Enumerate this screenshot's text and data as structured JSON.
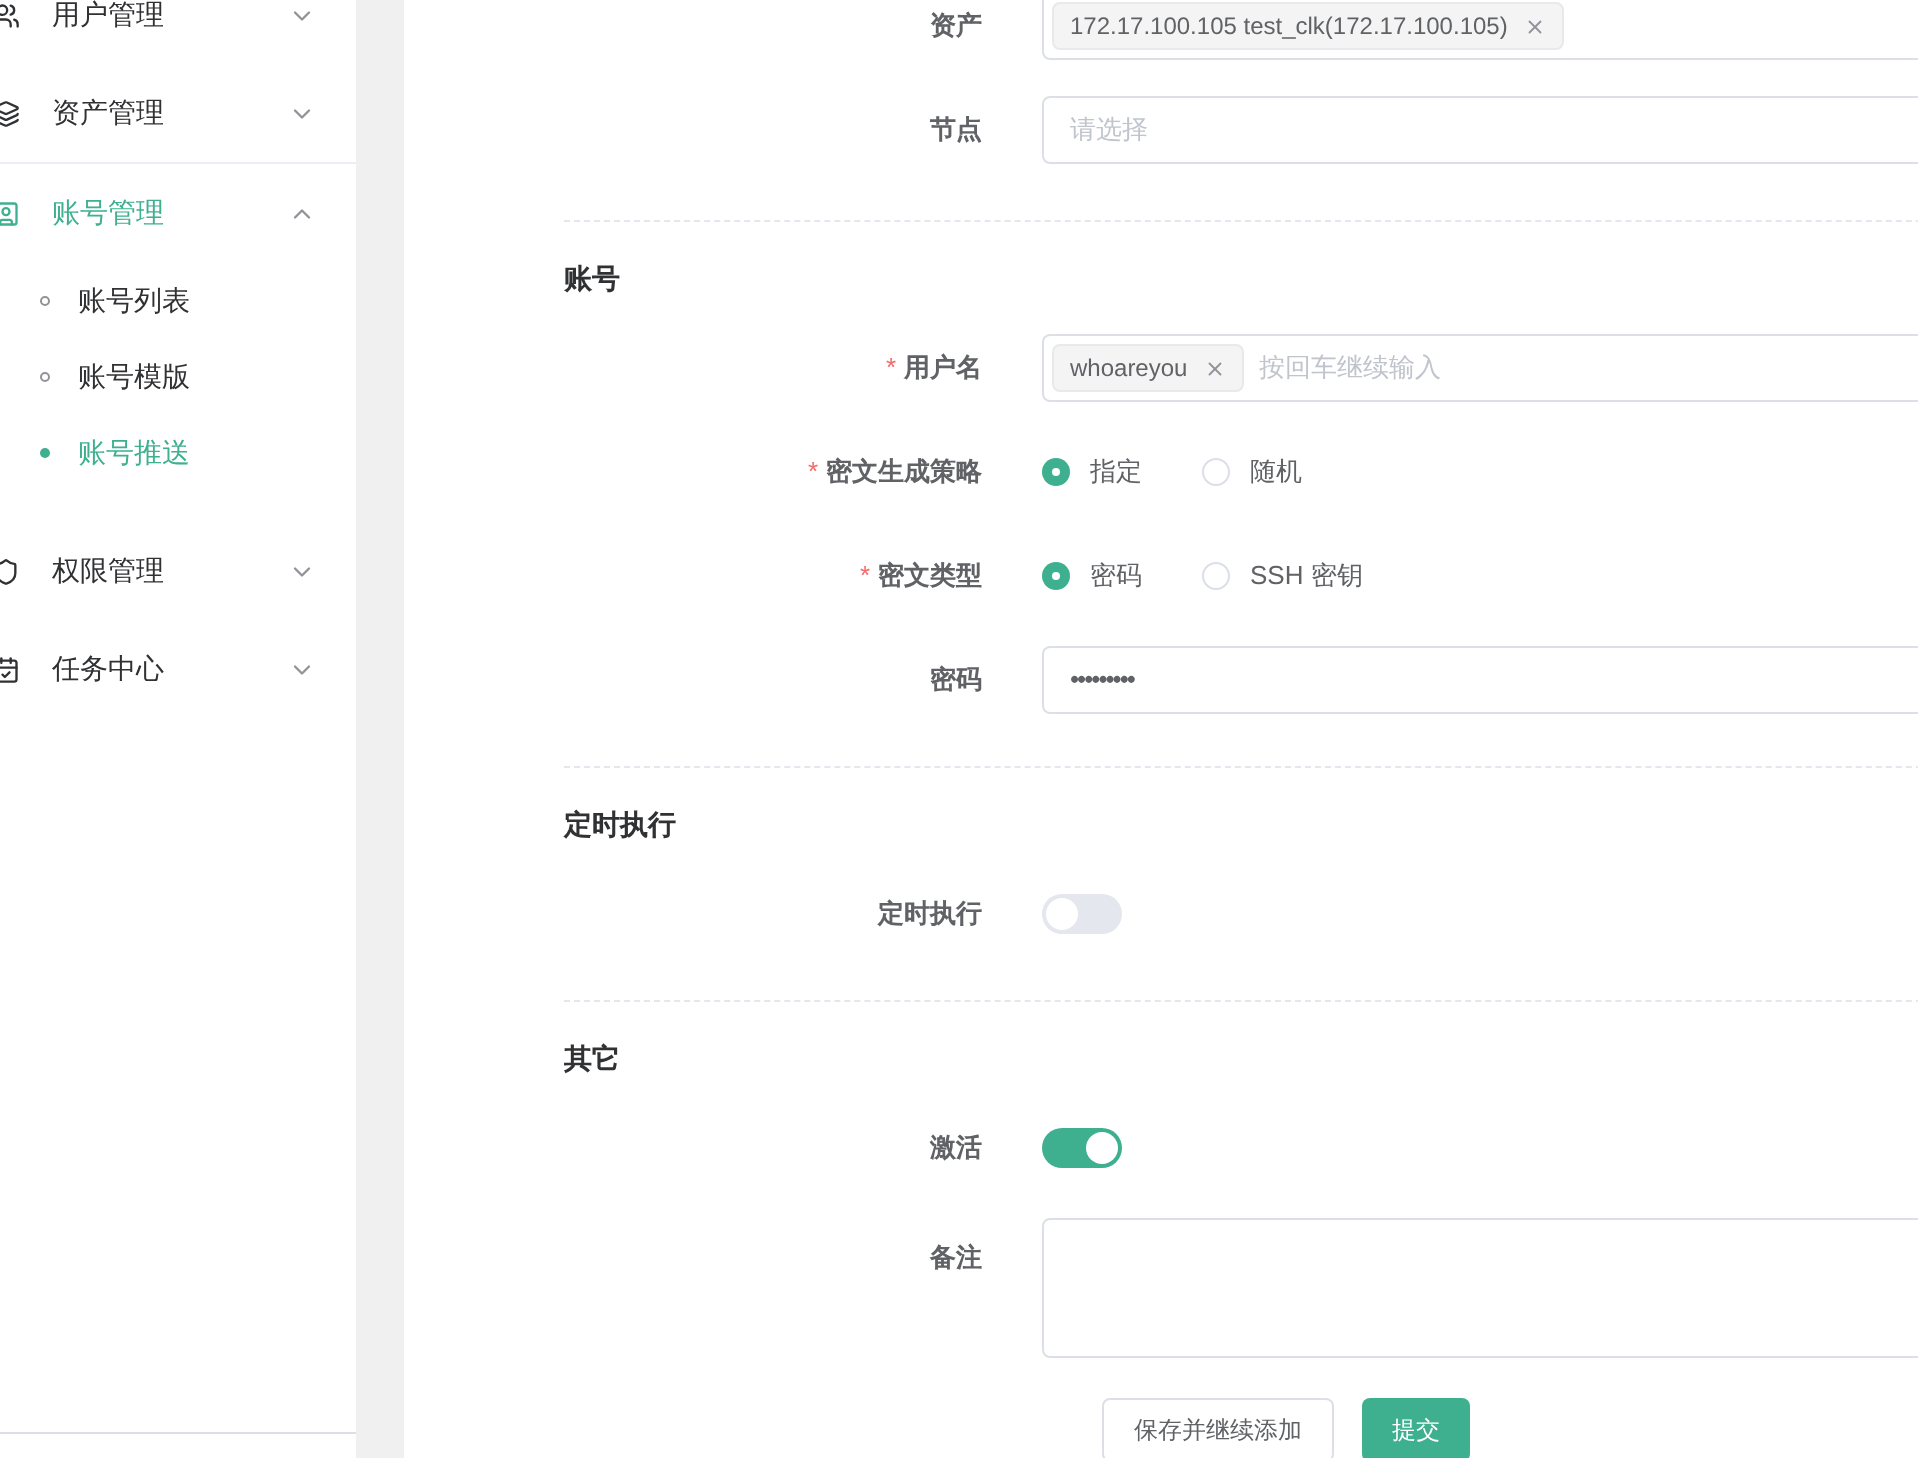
{
  "sidebar": {
    "items": [
      {
        "label": "用户管理",
        "selected": false,
        "expanded": false
      },
      {
        "label": "资产管理",
        "selected": false,
        "expanded": false
      },
      {
        "label": "账号管理",
        "selected": true,
        "expanded": true,
        "children": [
          {
            "label": "账号列表",
            "selected": false
          },
          {
            "label": "账号模版",
            "selected": false
          },
          {
            "label": "账号推送",
            "selected": true
          }
        ]
      },
      {
        "label": "权限管理",
        "selected": false,
        "expanded": false
      },
      {
        "label": "任务中心",
        "selected": false,
        "expanded": false
      }
    ]
  },
  "form": {
    "sections": [
      {
        "fields": [
          {
            "label": "资产",
            "kind": "tags",
            "tags": [
              "172.17.100.105 test_clk(172.17.100.105)"
            ]
          },
          {
            "label": "节点",
            "kind": "select",
            "placeholder": "请选择"
          }
        ]
      },
      {
        "heading": "账号",
        "fields": [
          {
            "label": "用户名",
            "kind": "tags",
            "required_mark": "*",
            "tags": [
              "whoareyou"
            ],
            "placeholder": "按回车继续输入"
          },
          {
            "label": "密文生成策略",
            "kind": "radio",
            "required_mark": "*",
            "options": [
              {
                "label": "指定",
                "selected": true
              },
              {
                "label": "随机",
                "selected": false
              }
            ]
          },
          {
            "label": "密文类型",
            "kind": "radio",
            "required_mark": "*",
            "options": [
              {
                "label": "密码",
                "selected": true
              },
              {
                "label": "SSH 密钥",
                "selected": false
              }
            ]
          },
          {
            "label": "密码",
            "kind": "password",
            "value": "•••••••••"
          }
        ]
      },
      {
        "heading": "定时执行",
        "fields": [
          {
            "label": "定时执行",
            "kind": "switch",
            "on": false
          }
        ]
      },
      {
        "heading": "其它",
        "fields": [
          {
            "label": "激活",
            "kind": "switch",
            "on": true
          },
          {
            "label": "备注",
            "kind": "textarea"
          }
        ]
      }
    ],
    "buttons": [
      {
        "label": "保存并继续添加",
        "kind": "default"
      },
      {
        "label": "提交",
        "kind": "primary"
      }
    ]
  }
}
